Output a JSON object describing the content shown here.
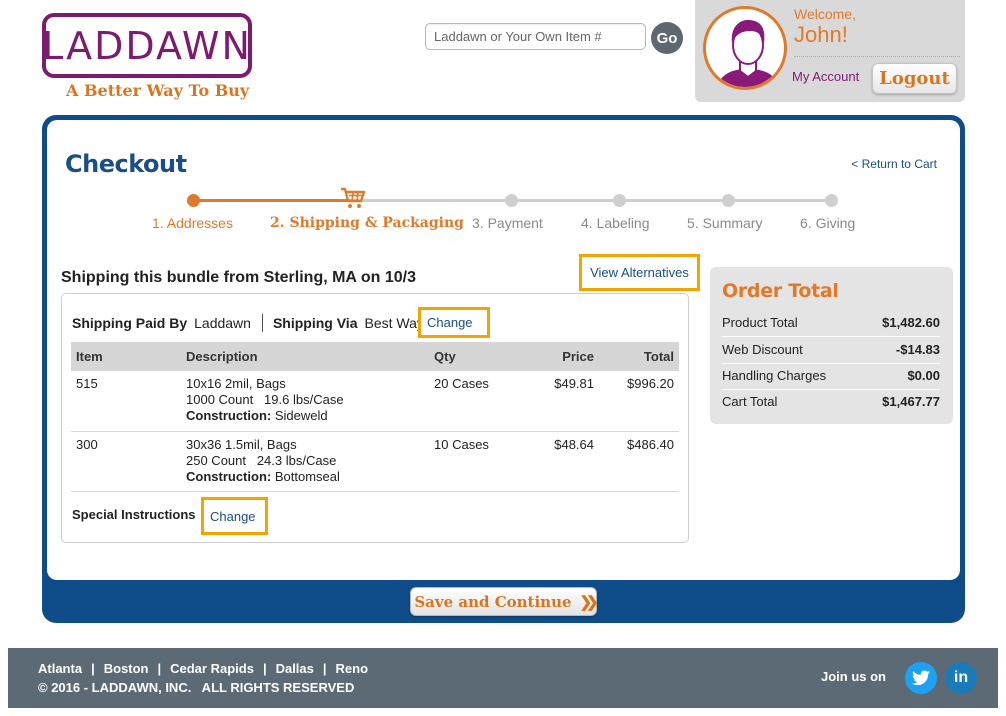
{
  "header": {
    "logo_text": "LADDAWN",
    "tagline": "A Better Way To Buy",
    "search_placeholder": "Laddawn or Your Own Item #",
    "go_label": "Go",
    "welcome": "Welcome,",
    "user_name": "John!",
    "my_account": "My Account",
    "logout": "Logout"
  },
  "checkout": {
    "title": "Checkout",
    "return_link": "< Return to Cart",
    "steps": [
      {
        "label": "1. Addresses",
        "state": "done"
      },
      {
        "label": "2. Shipping & Packaging",
        "state": "current"
      },
      {
        "label": "3. Payment",
        "state": "pending"
      },
      {
        "label": "4. Labeling",
        "state": "pending"
      },
      {
        "label": "5. Summary",
        "state": "pending"
      },
      {
        "label": "6. Giving",
        "state": "pending"
      }
    ]
  },
  "bundle": {
    "heading": "Shipping this bundle from Sterling, MA on 10/3",
    "view_alternatives": "View Alternatives",
    "shipping_paid_by_label": "Shipping Paid By",
    "shipping_paid_by_value": "Laddawn",
    "shipping_via_label": "Shipping Via",
    "shipping_via_value": "Best Way",
    "change_label": "Change",
    "columns": [
      "Item",
      "Description",
      "Qty",
      "Price",
      "Total"
    ],
    "rows": [
      {
        "item": "515",
        "desc1": "10x16 2mil, Bags",
        "desc2": "1000 Count   19.6 lbs/Case",
        "construction_label": "Construction:",
        "construction": "Sideweld",
        "qty": "20 Cases",
        "price": "$49.81",
        "total": "$996.20"
      },
      {
        "item": "300",
        "desc1": "30x36 1.5mil, Bags",
        "desc2": "250 Count   24.3 lbs/Case",
        "construction_label": "Construction:",
        "construction": "Bottomseal",
        "qty": "10 Cases",
        "price": "$48.64",
        "total": "$486.40"
      }
    ],
    "special_instructions_label": "Special Instructions",
    "special_change_label": "Change"
  },
  "order_total": {
    "title": "Order Total",
    "rows": [
      {
        "label": "Product Total",
        "amount": "$1,482.60"
      },
      {
        "label": "Web Discount",
        "amount": "-$14.83"
      },
      {
        "label": "Handling Charges",
        "amount": "$0.00"
      },
      {
        "label": "Cart Total",
        "amount": "$1,467.77"
      }
    ]
  },
  "save_continue": "Save and Continue",
  "footer": {
    "locations": [
      "Atlanta",
      "Boston",
      "Cedar Rapids",
      "Dallas",
      "Reno"
    ],
    "copyright": "© 2016 - LADDAWN, INC.   ALL RIGHTS RESERVED",
    "join": "Join us on",
    "social": [
      "twitter-icon",
      "linkedin-icon"
    ]
  },
  "colors": {
    "brand_purple": "#7b1c6e",
    "accent_orange": "#e07a2a",
    "frame_blue": "#0f4c8a",
    "highlight_yellow": "#f0a500",
    "footer_gray": "#5c6a76"
  }
}
